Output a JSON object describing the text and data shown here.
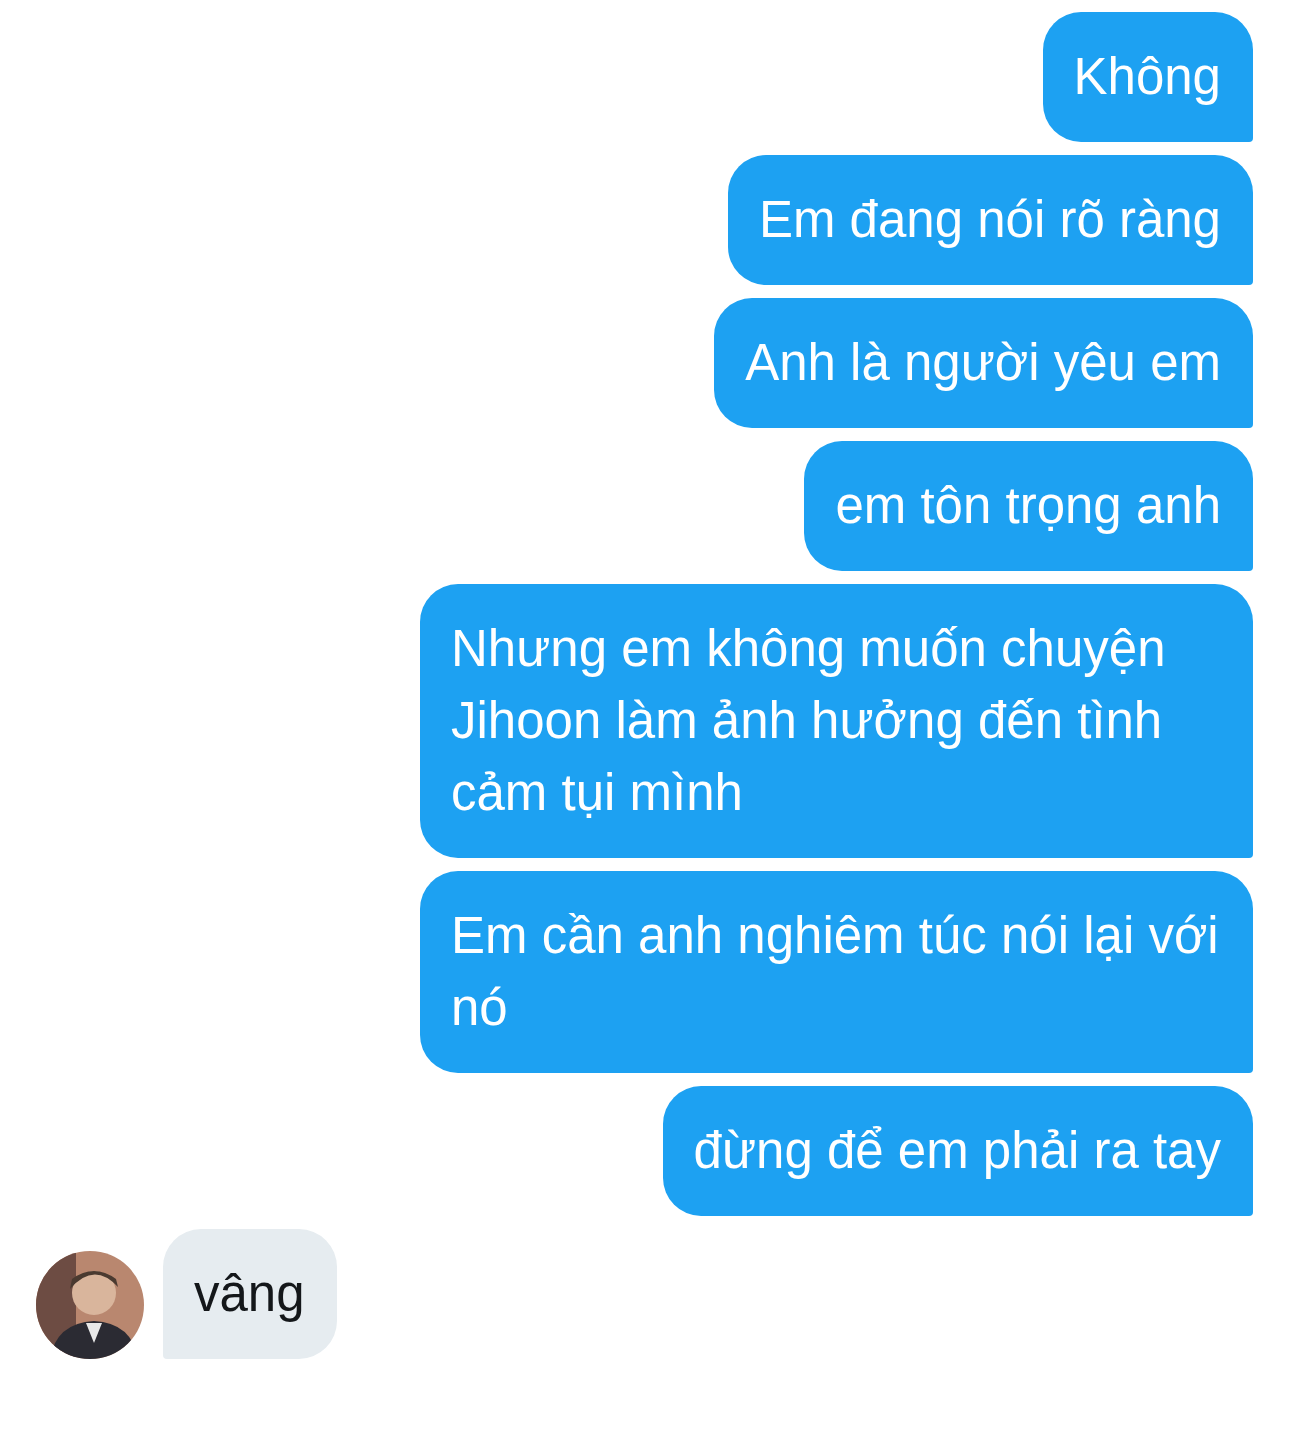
{
  "messages": [
    {
      "kind": "sent",
      "text": "Không"
    },
    {
      "kind": "sent",
      "text": "Em đang nói rõ ràng"
    },
    {
      "kind": "sent",
      "text": "Anh là người yêu em"
    },
    {
      "kind": "sent",
      "text": "em tôn trọng anh"
    },
    {
      "kind": "sent",
      "text": "Nhưng em không muốn chuyện Jihoon làm ảnh hưởng đến tình cảm tụi mình"
    },
    {
      "kind": "sent",
      "text": "Em cần anh nghiêm túc nói lại với nó"
    },
    {
      "kind": "sent",
      "text": "đừng để em phải ra tay"
    },
    {
      "kind": "received",
      "text": "vâng"
    }
  ]
}
